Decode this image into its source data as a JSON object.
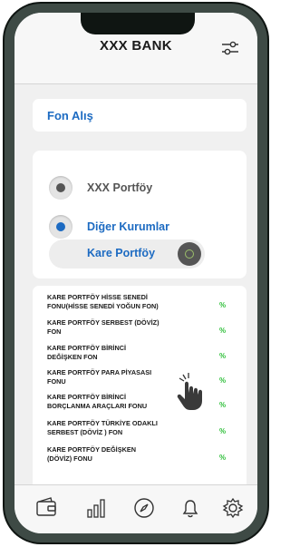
{
  "header": {
    "title": "XXX BANK",
    "filter_icon": "sliders-icon"
  },
  "section_title": "Fon Alış",
  "radio_options": [
    {
      "label": "XXX Portföy",
      "selected": false,
      "color": "#555555"
    },
    {
      "label": "Diğer Kurumlar",
      "selected": true,
      "color": "#1d6bc2"
    }
  ],
  "portfolio_pill": {
    "label": "Kare Portföy",
    "button_icon": "circle-arrow-icon"
  },
  "funds": [
    {
      "name_line1": "KARE PORTFÖY HİSSE SENEDİ",
      "name_line2": "FONU(HİSSE SENEDİ YOĞUN FON)",
      "pct": "%"
    },
    {
      "name_line1": "KARE PORTFÖY SERBEST (DÖVİZ)",
      "name_line2": "FON",
      "pct": "%"
    },
    {
      "name_line1": "KARE PORTFÖY BİRİNCİ",
      "name_line2": "DEĞİŞKEN FON",
      "pct": "%"
    },
    {
      "name_line1": "KARE PORTFÖY PARA PİYASASI",
      "name_line2": "FONU",
      "pct": "%"
    },
    {
      "name_line1": "KARE PORTFÖY BİRİNCİ",
      "name_line2": "BORÇLANMA ARAÇLARI FONU",
      "pct": "%"
    },
    {
      "name_line1": "KARE PORTFÖY TÜRKİYE ODAKLI",
      "name_line2": "SERBEST (DÖVİZ ) FON",
      "pct": "%"
    },
    {
      "name_line1": "KARE PORTFÖY DEĞİŞKEN",
      "name_line2": "(DÖVİZ) FONU",
      "pct": "%"
    }
  ],
  "bottom_nav": [
    "wallet-icon",
    "bar-chart-icon",
    "compass-icon",
    "bell-icon",
    "gear-icon"
  ],
  "colors": {
    "accent": "#1d6bc2",
    "percent": "#2fbf3a",
    "frame": "#3e4a45"
  }
}
